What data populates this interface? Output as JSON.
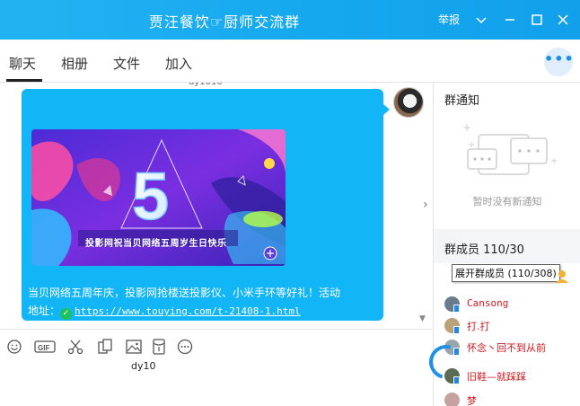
{
  "window": {
    "title": "贾汪餐饮☞厨师交流群",
    "report_label": "举报"
  },
  "tabs": [
    {
      "label": "聊天",
      "active": true
    },
    {
      "label": "相册",
      "active": false
    },
    {
      "label": "文件",
      "active": false
    },
    {
      "label": "加入",
      "active": false
    }
  ],
  "chat": {
    "cut_off_text": "dy1010",
    "banner": {
      "number": "5",
      "caption": "投影网祝当贝网络五周岁生日快乐"
    },
    "message_line1": "当贝网络五周年庆，投影网抢楼送投影仪、小米手环等好礼！活动",
    "message_line2_prefix": "地址：",
    "message_link": "https://www.touying.com/t-21408-1.html"
  },
  "input": {
    "draft_text": "dy10"
  },
  "side": {
    "notice_title": "群通知",
    "notice_empty": "暂时没有新通知",
    "members_title": "群成员 110/30",
    "members_tooltip": "展开群成员 (110/308)",
    "members": [
      {
        "name": "Cansong"
      },
      {
        "name": "打.打"
      },
      {
        "name": "怀念丶回不到从前"
      },
      {
        "name": "旧鞋—就踩踩"
      },
      {
        "name": "梦"
      }
    ]
  },
  "colors": {
    "titlebar": "#15a7ee",
    "bubble": "#12b5f5",
    "member_name": "#d2191f",
    "accent": "#1b8fe6"
  }
}
